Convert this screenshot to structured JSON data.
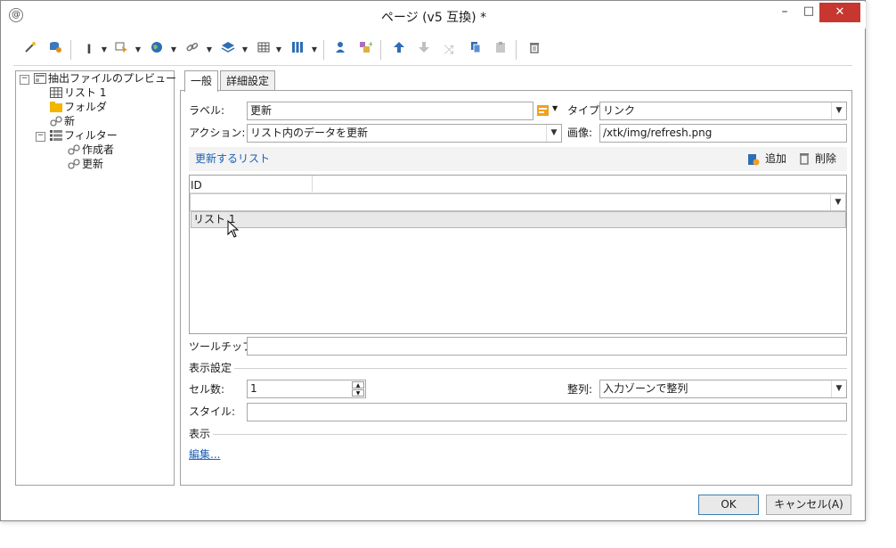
{
  "window": {
    "title": "ページ (v5 互換) *",
    "minimize": "–",
    "maximize": "□",
    "close": "✕"
  },
  "toolbar": {
    "icons": [
      "wand-icon",
      "database-user-icon",
      "text-cursor-icon",
      "form-cursor-icon",
      "globe-icon",
      "link-icon",
      "layers-icon",
      "table-icon",
      "columns-icon",
      "user-icon",
      "add-object-icon",
      "arrow-up-icon",
      "arrow-down-icon",
      "shuffle-icon",
      "copy-icon",
      "paste-icon",
      "trash-icon"
    ]
  },
  "tree": {
    "root": "抽出ファイルのプレビュー",
    "items": [
      {
        "label": "リスト 1",
        "icon": "grid-icon"
      },
      {
        "label": "フォルダ",
        "icon": "folder-icon"
      },
      {
        "label": "新",
        "icon": "link-icon"
      },
      {
        "label": "フィルター",
        "icon": "list-icon"
      },
      {
        "label": "作成者",
        "icon": "link-icon"
      },
      {
        "label": "更新",
        "icon": "link-icon"
      }
    ]
  },
  "tabs": [
    "一般",
    "詳細設定"
  ],
  "form": {
    "label_label": "ラベル:",
    "label_value": "更新",
    "type_label": "タイプ:",
    "type_value": "リンク",
    "action_label": "アクション:",
    "action_value": "リスト内のデータを更新",
    "image_label": "画像:",
    "image_value": "/xtk/img/refresh.png"
  },
  "list_section": {
    "title": "更新するリスト",
    "add": "追加",
    "delete": "削除",
    "column_header": "ID",
    "rows": [
      "リスト 1"
    ]
  },
  "tooltip": {
    "label": "ツールチップ:",
    "value": ""
  },
  "display_settings": {
    "title": "表示設定",
    "cells_label": "セル数:",
    "cells_value": "1",
    "align_label": "整列:",
    "align_value": "入力ゾーンで整列",
    "style_label": "スタイル:",
    "style_value": ""
  },
  "display": {
    "title": "表示",
    "edit_link": "編集..."
  },
  "buttons": {
    "ok": "OK",
    "cancel": "キャンセル(A)"
  },
  "colors": {
    "close_button": "#c7372f",
    "link": "#1a5fb4",
    "selected_row": "#e8e8e8"
  }
}
